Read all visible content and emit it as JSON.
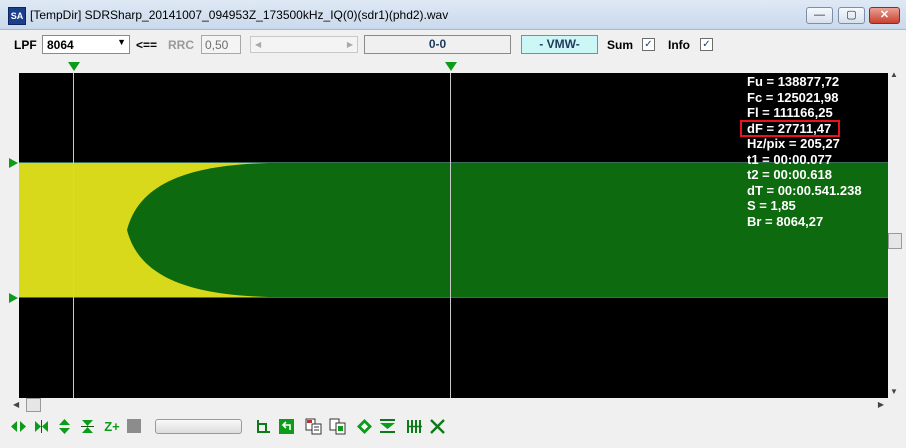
{
  "window": {
    "title": "[TempDir] SDRSharp_20141007_094953Z_173500kHz_IQ(0)(sdr1)(phd2).wav",
    "icon_text": "SA",
    "minimize_glyph": "—",
    "maximize_glyph": "▢",
    "close_glyph": "✕"
  },
  "toolbar": {
    "lpf_label": "LPF",
    "lpf_value": "8064",
    "arrow_label": "<==",
    "rrc_label": "RRC",
    "rrc_value": "0,50",
    "range_display": "0-0",
    "mode_display": "- VMW-",
    "sum_label": "Sum",
    "sum_checked": "✓",
    "info_label": "Info",
    "info_checked": "✓"
  },
  "info": {
    "lines": [
      "Fu = 138877,72",
      "Fc = 125021,98",
      "Fl = 111166,25",
      "dF = 27711,47",
      "Hz/pix = 205,27",
      "t1 = 00:00.077",
      "t2 = 00:00.618",
      "dT = 00:00.541.238",
      "S = 1,85",
      "Br = 8064,27"
    ],
    "highlighted_index": 3
  },
  "colors": {
    "plot_background": "#000000",
    "signal_green": "#0e6a0e",
    "signal_yellow": "#d9d91c",
    "marker_green": "#0c9c1a",
    "highlight_red": "#e8141c",
    "vmw_background": "#cdf7f7"
  },
  "icons": {
    "bottom_toolbar": [
      "expand-horizontal-icon",
      "collapse-horizontal-icon",
      "expand-vertical-icon",
      "collapse-vertical-icon",
      "zoom-plus-icon",
      "stop-icon",
      "baseline-icon",
      "undo-icon",
      "copy-text-icon",
      "copy-image-icon",
      "diamond-icon",
      "filter-icon",
      "bars-icon",
      "cross-icon"
    ],
    "zoom_plus_text": "Z+"
  }
}
